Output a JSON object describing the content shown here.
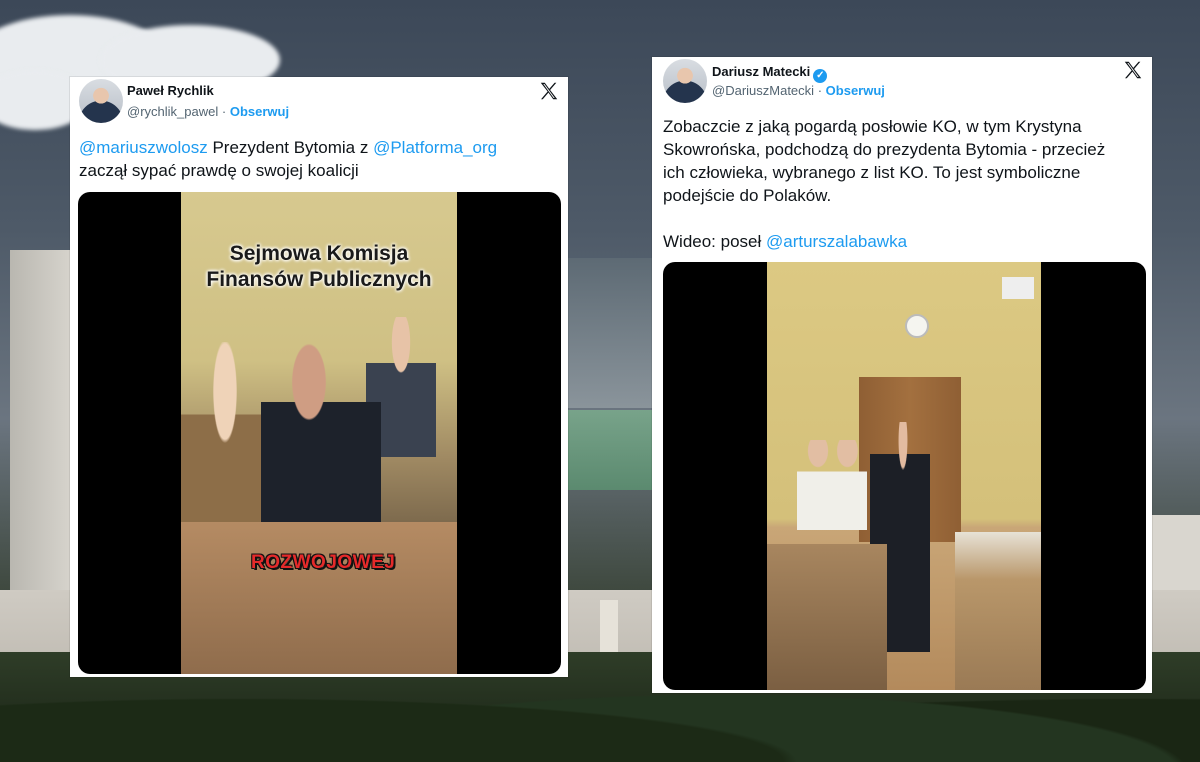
{
  "tweet1": {
    "author_name": "Paweł Rychlik",
    "author_handle": "@rychlik_pawel",
    "separator": "·",
    "follow_label": "Obserwuj",
    "mention1": "@mariuszwolosz",
    "text_part1": " Prezydent Bytomia z ",
    "mention2": "@Platforma_org",
    "text_part2": "zaczął sypać prawdę o swojej koalicji",
    "video": {
      "caption_line1": "Sejmowa Komisja",
      "caption_line2": "Finansów Publicznych",
      "subtitle": "ROZWOJOWEJ"
    }
  },
  "tweet2": {
    "author_name": "Dariusz Matecki",
    "author_handle": "@DariuszMatecki",
    "separator": "·",
    "follow_label": "Obserwuj",
    "text_line1": "Zobaczcie z jaką pogardą posłowie KO, w tym Krystyna",
    "text_line2": "Skowrońska, podchodzą do prezydenta Bytomia - przecież",
    "text_line3": "ich człowieka, wybranego z list KO. To jest symboliczne",
    "text_line4": "podejście do Polaków.",
    "video_credit_prefix": "Wideo: poseł ",
    "video_credit_mention": "@arturszalabawka"
  },
  "icons": {
    "x_logo": "x-logo-icon",
    "verified": "verified-badge-icon"
  },
  "colors": {
    "link": "#1d9bf0",
    "text": "#0f1419",
    "muted": "#536471",
    "subtitle_red": "#e52a2a"
  }
}
